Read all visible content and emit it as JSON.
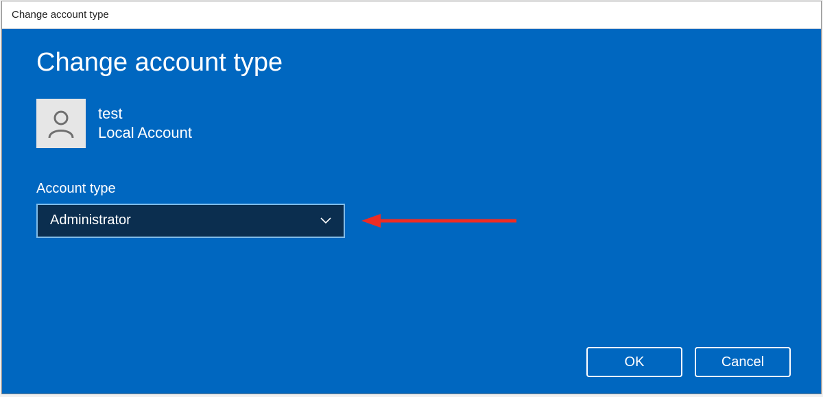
{
  "window": {
    "title": "Change account type"
  },
  "dialog": {
    "heading": "Change account type",
    "user": {
      "name": "test",
      "subtitle": "Local Account"
    },
    "field_label": "Account type",
    "selected": "Administrator",
    "buttons": {
      "ok": "OK",
      "cancel": "Cancel"
    }
  },
  "icons": {
    "avatar": "person-icon",
    "chevron": "chevron-down-icon",
    "annotation": "arrow-left-red"
  },
  "colors": {
    "primary": "#0067c0",
    "select_bg": "#0b2e4f",
    "select_border": "#7fbce9",
    "annotation_red": "#ee2c24"
  }
}
